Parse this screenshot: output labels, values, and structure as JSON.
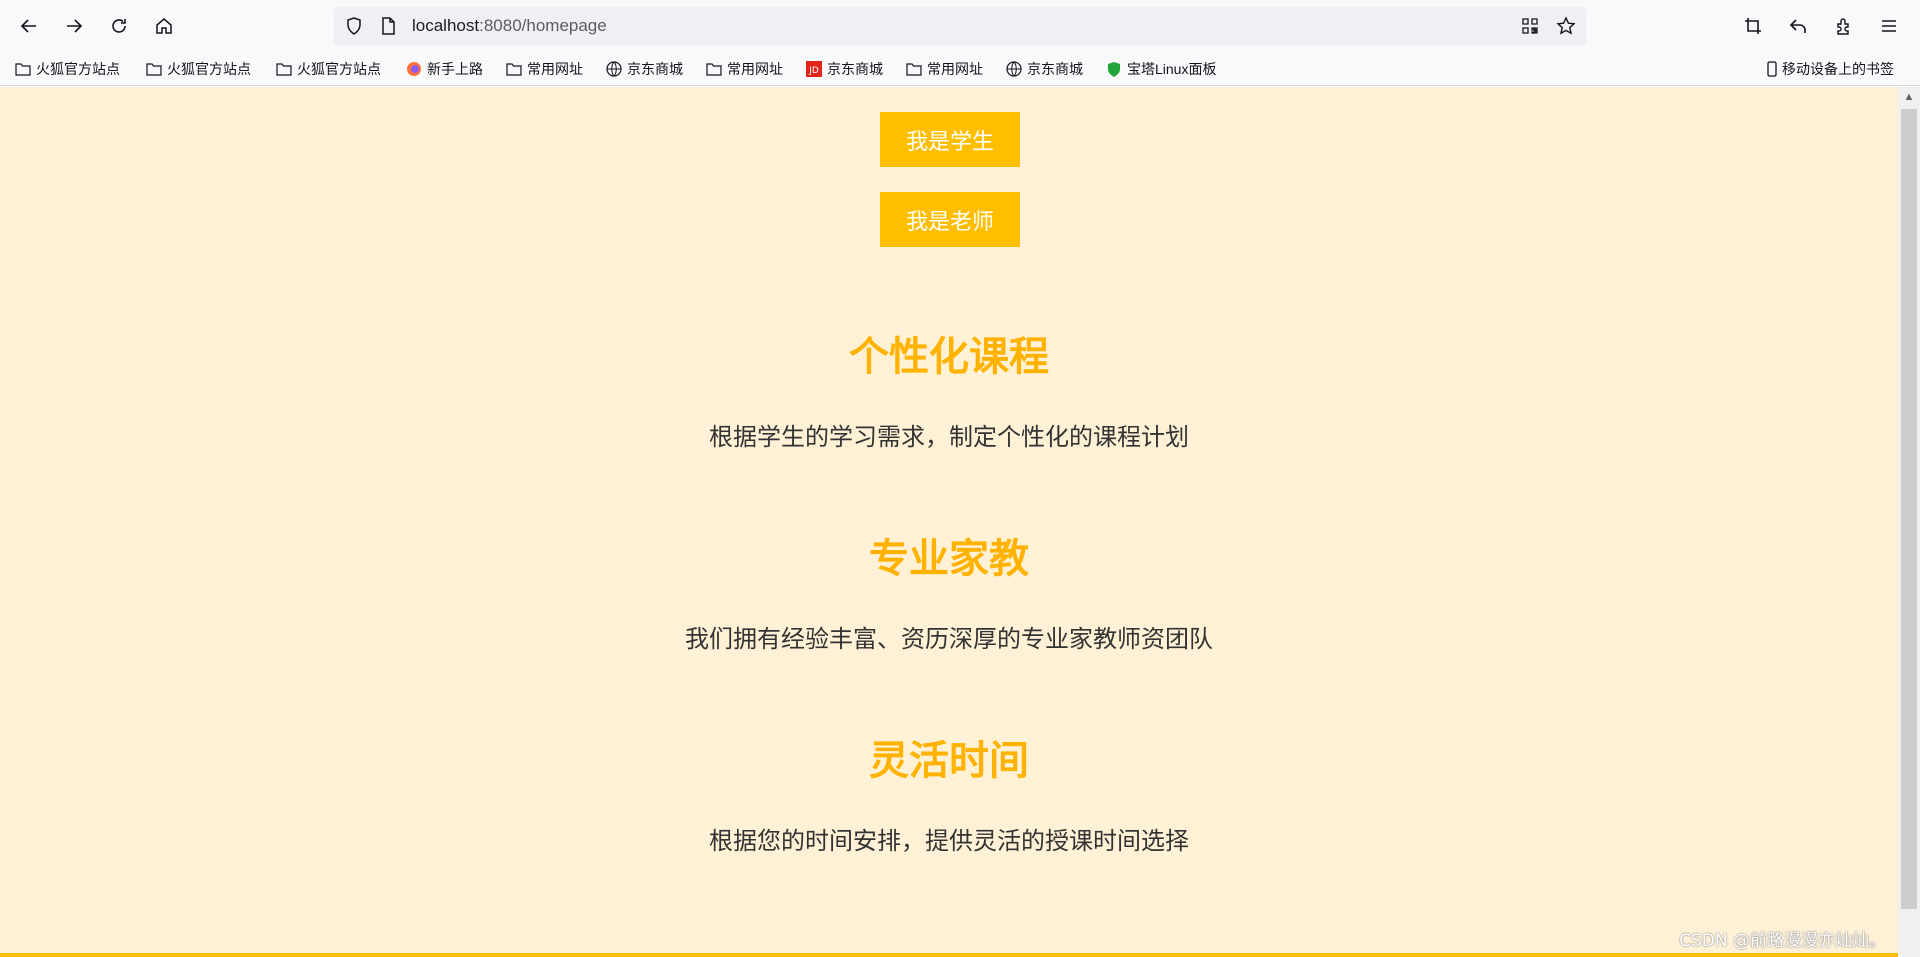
{
  "browser": {
    "url_host": "localhost",
    "url_path": ":8080/homepage",
    "icons": {
      "back": "back-arrow-icon",
      "forward": "forward-arrow-icon",
      "reload": "reload-icon",
      "home": "home-icon",
      "shield": "tracking-shield-icon",
      "page": "page-icon",
      "qr": "qr-code-icon",
      "star": "bookmark-star-icon",
      "crop": "screenshot-crop-icon",
      "undo": "undo-icon",
      "extensions": "extensions-icon",
      "menu": "hamburger-menu-icon"
    }
  },
  "bookmarks": {
    "items": [
      {
        "label": "火狐官方站点",
        "icon": "folder"
      },
      {
        "label": "火狐官方站点",
        "icon": "folder"
      },
      {
        "label": "火狐官方站点",
        "icon": "folder"
      },
      {
        "label": "新手上路",
        "icon": "firefox"
      },
      {
        "label": "常用网址",
        "icon": "folder"
      },
      {
        "label": "京东商城",
        "icon": "globe"
      },
      {
        "label": "常用网址",
        "icon": "folder"
      },
      {
        "label": "京东商城",
        "icon": "jd"
      },
      {
        "label": "常用网址",
        "icon": "folder"
      },
      {
        "label": "京东商城",
        "icon": "globe"
      },
      {
        "label": "宝塔Linux面板",
        "icon": "baota"
      }
    ],
    "mobile": "移动设备上的书签"
  },
  "main": {
    "student_button": "我是学生",
    "teacher_button": "我是老师",
    "features": [
      {
        "title": "个性化课程",
        "desc": "根据学生的学习需求，制定个性化的课程计划"
      },
      {
        "title": "专业家教",
        "desc": "我们拥有经验丰富、资历深厚的专业家教师资团队"
      },
      {
        "title": "灵活时间",
        "desc": "根据您的时间安排，提供灵活的授课时间选择"
      }
    ]
  },
  "watermark": "CSDN @前路漫漫亦灿灿。",
  "colors": {
    "page_bg": "#fff1d6",
    "accent": "#ffbf00",
    "title": "#ffb300",
    "text": "#333333"
  }
}
